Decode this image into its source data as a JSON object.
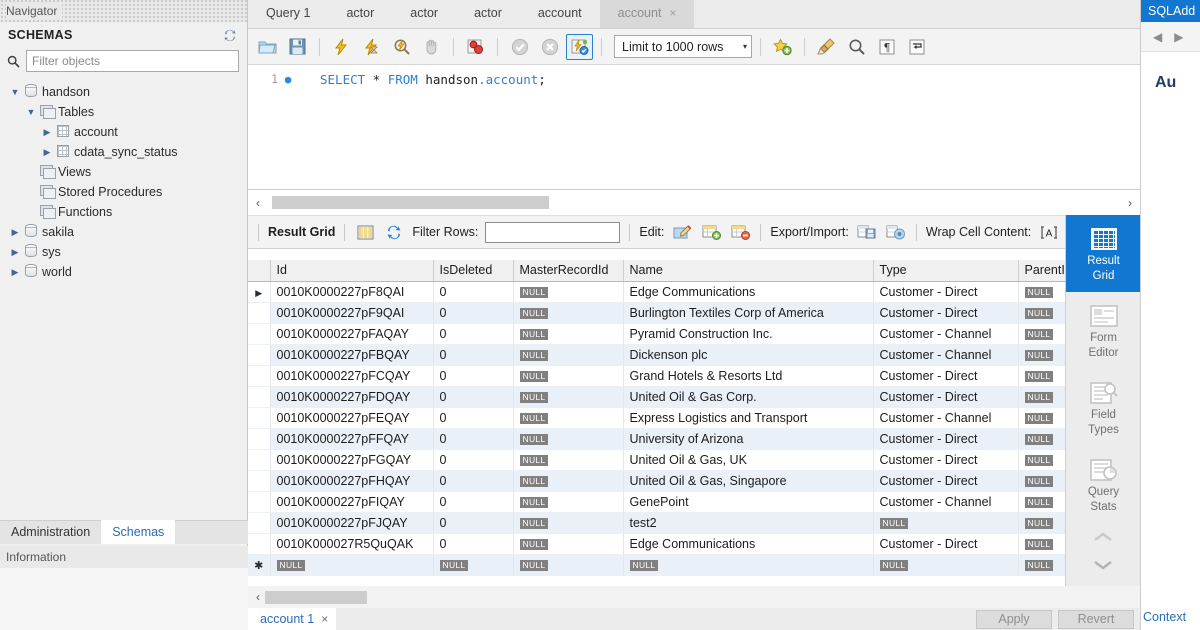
{
  "navigator": {
    "panel_title": "Navigator",
    "schemas_label": "SCHEMAS",
    "refresh_icon": "refresh-icon",
    "search_icon": "search-icon",
    "filter_placeholder": "Filter objects",
    "tree": [
      {
        "label": "handson",
        "icon": "database-icon",
        "depth": 0,
        "expanded": true
      },
      {
        "label": "Tables",
        "icon": "folder-stack-icon",
        "depth": 1,
        "expanded": true
      },
      {
        "label": "account",
        "icon": "table-icon",
        "depth": 2,
        "expanded": false
      },
      {
        "label": "cdata_sync_status",
        "icon": "table-icon",
        "depth": 2,
        "expanded": false
      },
      {
        "label": "Views",
        "icon": "folder-stack-icon",
        "depth": 1,
        "expanded": null
      },
      {
        "label": "Stored Procedures",
        "icon": "folder-stack-icon",
        "depth": 1,
        "expanded": null
      },
      {
        "label": "Functions",
        "icon": "folder-stack-icon",
        "depth": 1,
        "expanded": null
      },
      {
        "label": "sakila",
        "icon": "database-icon",
        "depth": 0,
        "expanded": false
      },
      {
        "label": "sys",
        "icon": "database-icon",
        "depth": 0,
        "expanded": false
      },
      {
        "label": "world",
        "icon": "database-icon",
        "depth": 0,
        "expanded": false
      }
    ],
    "bottom_tabs": [
      {
        "label": "Administration",
        "active": false
      },
      {
        "label": "Schemas",
        "active": true
      }
    ],
    "information_title": "Information"
  },
  "editor_tabs": [
    {
      "label": "Query 1",
      "active": false,
      "closable": false
    },
    {
      "label": "actor",
      "active": false,
      "closable": false
    },
    {
      "label": "actor",
      "active": false,
      "closable": false
    },
    {
      "label": "actor",
      "active": false,
      "closable": false
    },
    {
      "label": "account",
      "active": false,
      "closable": false
    },
    {
      "label": "account",
      "active": true,
      "closable": true,
      "close_label": "×"
    }
  ],
  "toolbar": {
    "buttons": [
      {
        "name": "open-sql-script-button",
        "icon": "folder-open-icon"
      },
      {
        "name": "save-sql-script-button",
        "icon": "floppy-save-icon"
      },
      {
        "name": "execute-statement-button",
        "icon": "lightning-bolt-icon"
      },
      {
        "name": "execute-current-statement-button",
        "icon": "lightning-bolt-cursor-icon"
      },
      {
        "name": "explain-statement-button",
        "icon": "magnifier-lightning-icon"
      },
      {
        "name": "stop-button",
        "icon": "stop-hand-icon"
      },
      {
        "name": "toggle-breakpoint-button",
        "icon": "breakpoint-icon"
      },
      {
        "name": "commit-button",
        "icon": "check-circle-icon"
      },
      {
        "name": "rollback-button",
        "icon": "cancel-circle-icon"
      },
      {
        "name": "toggle-autocommit-button",
        "icon": "autocommit-icon"
      }
    ],
    "limit_label": "Limit to 1000 rows",
    "limit_caret": "▾",
    "right_buttons": [
      {
        "name": "toggle-snippets-button",
        "icon": "star-plus-icon"
      },
      {
        "name": "beautify-sql-button",
        "icon": "brush-icon"
      },
      {
        "name": "find-button",
        "icon": "magnifier-icon"
      },
      {
        "name": "toggle-invisible-chars-button",
        "icon": "pilcrow-icon"
      },
      {
        "name": "wrap-lines-button",
        "icon": "wrap-arrow-icon"
      }
    ]
  },
  "sql": {
    "line_number": "1",
    "bullet": "●",
    "tokens": [
      {
        "text": "SELECT",
        "cls": "kw"
      },
      {
        "text": " * ",
        "cls": "plain"
      },
      {
        "text": "FROM",
        "cls": "kw"
      },
      {
        "text": " handson",
        "cls": "sch"
      },
      {
        "text": ".account",
        "cls": "tblname"
      },
      {
        "text": ";",
        "cls": "plain"
      }
    ],
    "full_text": "SELECT * FROM handson.account;"
  },
  "scrollbars": {
    "left_arrow": "‹",
    "right_arrow": "›"
  },
  "grid_toolbar": {
    "result_grid_label": "Result Grid",
    "grid_icon": "column-grid-icon",
    "refresh_icon": "refresh-icon",
    "filter_rows_label": "Filter Rows:",
    "filter_rows_value": "",
    "edit_label": "Edit:",
    "edit_icons": [
      "edit-pencil-icon",
      "insert-row-icon",
      "delete-row-icon"
    ],
    "export_label": "Export/Import:",
    "export_icons": [
      "export-disk-icon",
      "import-disk-icon"
    ],
    "wrap_label": "Wrap Cell Content:",
    "wrap_icon": "wrap-cell-icon"
  },
  "result_table": {
    "columns": [
      "Id",
      "IsDeleted",
      "MasterRecordId",
      "Name",
      "Type",
      "ParentI"
    ],
    "null_text": "NULL",
    "row_marker": "▶",
    "new_row_marker": "✱",
    "rows": [
      {
        "Id": "0010K0000227pF8QAI",
        "IsDeleted": "0",
        "MasterRecordId": null,
        "Name": "Edge Communications",
        "Type": "Customer - Direct",
        "ParentI": null,
        "selected": true
      },
      {
        "Id": "0010K0000227pF9QAI",
        "IsDeleted": "0",
        "MasterRecordId": null,
        "Name": "Burlington Textiles Corp of America",
        "Type": "Customer - Direct",
        "ParentI": null,
        "selected": false
      },
      {
        "Id": "0010K0000227pFAQAY",
        "IsDeleted": "0",
        "MasterRecordId": null,
        "Name": "Pyramid Construction Inc.",
        "Type": "Customer - Channel",
        "ParentI": null,
        "selected": false
      },
      {
        "Id": "0010K0000227pFBQAY",
        "IsDeleted": "0",
        "MasterRecordId": null,
        "Name": "Dickenson plc",
        "Type": "Customer - Channel",
        "ParentI": null,
        "selected": false
      },
      {
        "Id": "0010K0000227pFCQAY",
        "IsDeleted": "0",
        "MasterRecordId": null,
        "Name": "Grand Hotels & Resorts Ltd",
        "Type": "Customer - Direct",
        "ParentI": null,
        "selected": false
      },
      {
        "Id": "0010K0000227pFDQAY",
        "IsDeleted": "0",
        "MasterRecordId": null,
        "Name": "United Oil & Gas Corp.",
        "Type": "Customer - Direct",
        "ParentI": null,
        "selected": false
      },
      {
        "Id": "0010K0000227pFEQAY",
        "IsDeleted": "0",
        "MasterRecordId": null,
        "Name": "Express Logistics and Transport",
        "Type": "Customer - Channel",
        "ParentI": null,
        "selected": false
      },
      {
        "Id": "0010K0000227pFFQAY",
        "IsDeleted": "0",
        "MasterRecordId": null,
        "Name": "University of Arizona",
        "Type": "Customer - Direct",
        "ParentI": null,
        "selected": false
      },
      {
        "Id": "0010K0000227pFGQAY",
        "IsDeleted": "0",
        "MasterRecordId": null,
        "Name": "United Oil & Gas, UK",
        "Type": "Customer - Direct",
        "ParentI": null,
        "selected": false
      },
      {
        "Id": "0010K0000227pFHQAY",
        "IsDeleted": "0",
        "MasterRecordId": null,
        "Name": "United Oil & Gas, Singapore",
        "Type": "Customer - Direct",
        "ParentI": null,
        "selected": false
      },
      {
        "Id": "0010K0000227pFIQAY",
        "IsDeleted": "0",
        "MasterRecordId": null,
        "Name": "GenePoint",
        "Type": "Customer - Channel",
        "ParentI": null,
        "selected": false
      },
      {
        "Id": "0010K0000227pFJQAY",
        "IsDeleted": "0",
        "MasterRecordId": null,
        "Name": "test2",
        "Type": null,
        "ParentI": null,
        "selected": false
      },
      {
        "Id": "0010K000027R5QuQAK",
        "IsDeleted": "0",
        "MasterRecordId": null,
        "Name": "Edge Communications",
        "Type": "Customer - Direct",
        "ParentI": null,
        "selected": false
      },
      {
        "Id": null,
        "IsDeleted": null,
        "MasterRecordId": null,
        "Name": null,
        "Type": null,
        "ParentI": null,
        "new_row": true
      }
    ]
  },
  "rail": [
    {
      "label_line1": "Result",
      "label_line2": "Grid",
      "icon": "result-grid-icon",
      "active": true
    },
    {
      "label_line1": "Form",
      "label_line2": "Editor",
      "icon": "form-editor-icon",
      "active": false
    },
    {
      "label_line1": "Field",
      "label_line2": "Types",
      "icon": "field-types-icon",
      "active": false
    },
    {
      "label_line1": "Query",
      "label_line2": "Stats",
      "icon": "query-stats-icon",
      "active": false
    }
  ],
  "rail_chevrons": {
    "up": "⌃",
    "down": "⌄"
  },
  "bottom": {
    "result_tab_label": "account 1",
    "result_tab_close": "×",
    "apply_label": "Apply",
    "revert_label": "Revert"
  },
  "right_panel": {
    "title": "SQLAdd",
    "nav_back": "◀",
    "nav_forward": "▶",
    "heading": "Au"
  },
  "colors": {
    "accent_blue": "#1177d1",
    "tab_active_bg": "#d9d9d9",
    "row_alt": "#eaf0f8",
    "null_badge": "#808080",
    "sql_keyword": "#2b7fd4",
    "link_blue": "#2a6db5"
  }
}
